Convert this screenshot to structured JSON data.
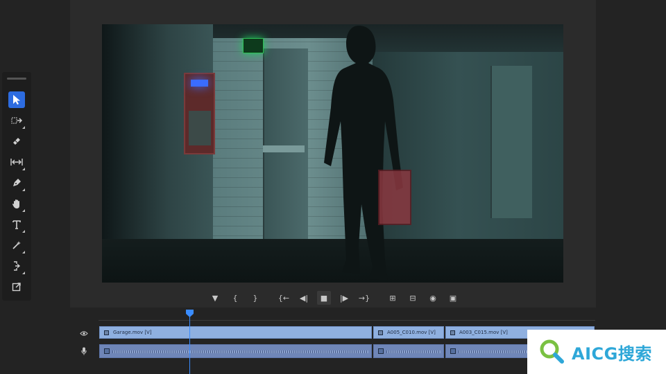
{
  "app": {
    "accent_color": "#2d6ce0",
    "playhead_color": "#3a8cff"
  },
  "tools": [
    {
      "name": "selection-tool",
      "icon": "arrow-pointer-icon",
      "active": true
    },
    {
      "name": "track-select-forward-tool",
      "icon": "track-select-icon",
      "active": false
    },
    {
      "name": "razor-tool",
      "icon": "razor-icon",
      "active": false
    },
    {
      "name": "slip-tool",
      "icon": "slip-icon",
      "active": false
    },
    {
      "name": "pen-tool",
      "icon": "pen-icon",
      "active": false
    },
    {
      "name": "hand-tool",
      "icon": "hand-icon",
      "active": false
    },
    {
      "name": "type-tool",
      "icon": "type-icon",
      "active": false
    },
    {
      "name": "magic-wand-tool",
      "icon": "magic-wand-icon",
      "active": false
    },
    {
      "name": "ripple-edit-tool",
      "icon": "ripple-edit-icon",
      "active": false
    },
    {
      "name": "export-frame-tool",
      "icon": "export-frame-icon",
      "active": false
    }
  ],
  "transport": {
    "glyphs": {
      "marker": "▼",
      "mark_in": "{",
      "mark_out": "}",
      "go_to_in": "{←",
      "step_back": "◀|",
      "stop": "■",
      "step_forward": "|▶",
      "go_to_out": "→}",
      "insert": "⊞",
      "overwrite": "⊟",
      "export_frame": "◉",
      "compare": "▣"
    }
  },
  "timeline": {
    "video_track_icon": "eye-icon",
    "audio_track_icon": "microphone-icon",
    "video_clips": [
      {
        "label": "Garage.mov [V]"
      },
      {
        "label": "A005_C010.mov [V]"
      },
      {
        "label": "A003_C015.mov [V]"
      }
    ]
  },
  "watermark": {
    "text": "AICG搜索"
  }
}
